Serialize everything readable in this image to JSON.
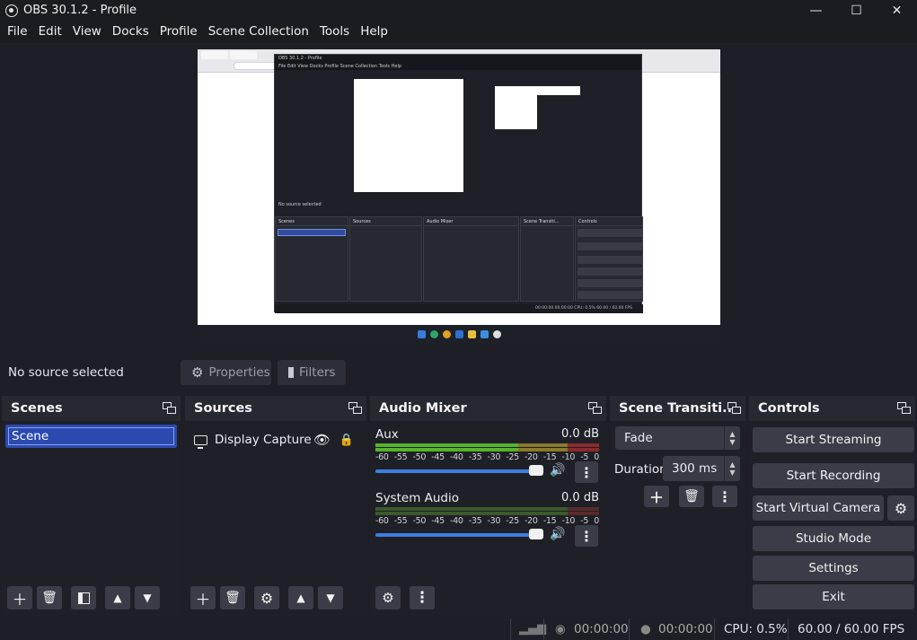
{
  "window": {
    "title": "OBS 30.1.2 - Profile"
  },
  "menu": [
    "File",
    "Edit",
    "View",
    "Docks",
    "Profile",
    "Scene Collection",
    "Tools",
    "Help"
  ],
  "preview": {
    "inner_title": "OBS 30.1.2 - Profile",
    "inner_menu": "File  Edit  View  Docks  Profile  Scene Collection  Tools  Help",
    "inner_no_source": "No source selected",
    "inner_panels": [
      "Scenes",
      "Sources",
      "Audio Mixer",
      "Scene Transiti...",
      "Controls"
    ],
    "inner_status": "00:00:00   00:00:00   CPU: 0.5%   60.00 / 60.00 FPS"
  },
  "context": {
    "no_source": "No source selected",
    "properties": "Properties",
    "filters": "Filters"
  },
  "scenes": {
    "title": "Scenes",
    "items": [
      "Scene"
    ]
  },
  "sources": {
    "title": "Sources",
    "items": [
      {
        "name": "Display Capture",
        "icon": "monitor-icon"
      }
    ]
  },
  "mixer": {
    "title": "Audio Mixer",
    "channels": [
      {
        "name": "Aux",
        "db": "0.0 dB",
        "volume": 1.0
      },
      {
        "name": "System Audio",
        "db": "0.0 dB",
        "volume": 1.0
      }
    ],
    "ticks": [
      "-60",
      "-55",
      "-50",
      "-45",
      "-40",
      "-35",
      "-30",
      "-25",
      "-20",
      "-15",
      "-10",
      "-5",
      "0"
    ]
  },
  "transitions": {
    "title": "Scene Transiti...",
    "selected": "Fade",
    "duration_label": "Duration",
    "duration_value": "300 ms"
  },
  "controls": {
    "title": "Controls",
    "start_streaming": "Start Streaming",
    "start_recording": "Start Recording",
    "start_virtual_camera": "Start Virtual Camera",
    "studio_mode": "Studio Mode",
    "settings": "Settings",
    "exit": "Exit"
  },
  "status": {
    "stream_time": "00:00:00",
    "record_time": "00:00:00",
    "cpu": "CPU: 0.5%",
    "fps": "60.00 / 60.00 FPS"
  },
  "colors": {
    "background": "#1e1f26",
    "dock": "#272931",
    "selection": "#2a4ab0",
    "slider": "#3d7fe0",
    "meter_green": "#56b42a"
  }
}
